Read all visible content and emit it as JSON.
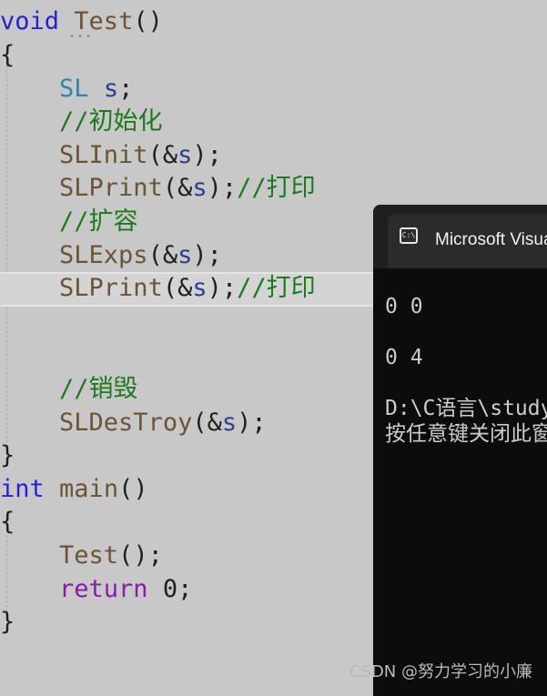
{
  "code": {
    "kw_void": "void",
    "fn_test": "Test",
    "parens": "()",
    "brace_open": "{",
    "brace_close": "}",
    "type_sl": "SL",
    "var_s": "s",
    "semicolon": ";",
    "comment_init": "//初始化",
    "fn_slinit": "SLInit",
    "fn_slprint": "SLPrint",
    "comment_print": "//打印",
    "comment_expand": "//扩容",
    "fn_slexps": "SLExps",
    "comment_destroy": "//销毁",
    "fn_sldestroy": "SLDesTroy",
    "arg_open": "(&",
    "arg_close": ")",
    "kw_int": "int",
    "fn_main": "main",
    "kw_return": "return",
    "num_zero": "0"
  },
  "console": {
    "title": "Microsoft Visual Studio 调试控制台",
    "icon": "terminal-icon",
    "icon_text": "C:\\",
    "output_lines": [
      "0 0",
      "0 4",
      "D:\\C语言\\study",
      "按任意键关闭此窗口. . ."
    ]
  },
  "watermark": "CSDN @努力学习的小廉",
  "colors": {
    "editor_bg": "#c8c8c8",
    "keyword": "#2323d6",
    "return_keyword": "#8a1aa8",
    "type": "#2e87a6",
    "function": "#6b5433",
    "comment": "#1c7a1c",
    "console_bg": "#0c0c0c"
  }
}
